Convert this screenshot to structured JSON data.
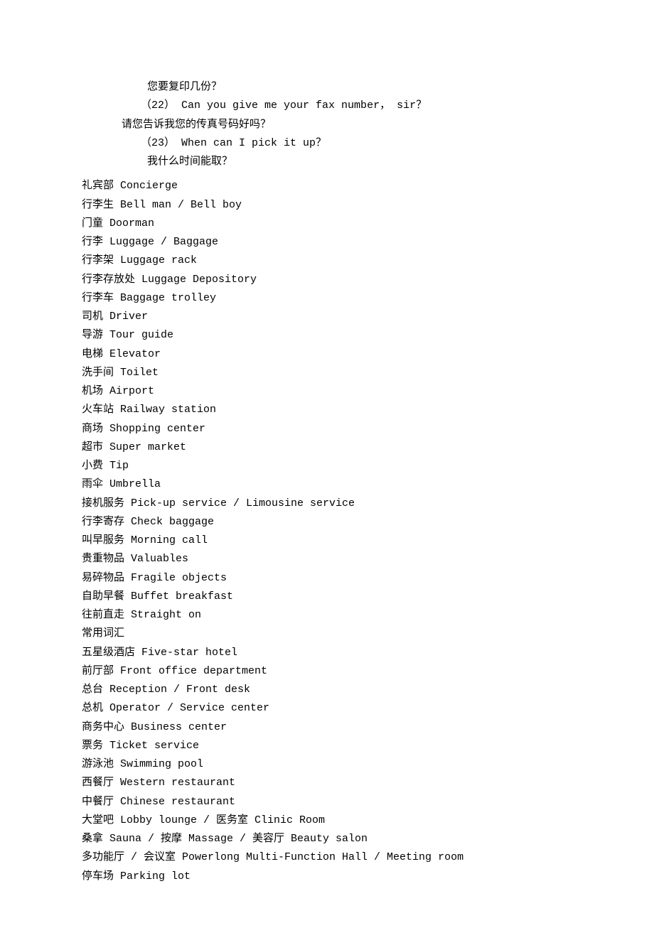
{
  "dialog": [
    "    您要复印几份？",
    "   （22） Can you give me your fax number， sir？",
    "请您告诉我您的传真号码好吗？",
    "   （23） When can I pick it up？",
    "    我什么时间能取？"
  ],
  "vocab": [
    "礼宾部 Concierge",
    "行李生 Bell man / Bell boy",
    "门童 Doorman",
    "行李 Luggage / Baggage",
    "行李架 Luggage rack",
    "行李存放处 Luggage Depository",
    "行李车 Baggage trolley",
    "司机 Driver",
    "导游 Tour guide",
    "电梯 Elevator",
    "洗手间 Toilet",
    "机场 Airport",
    "火车站 Railway station",
    "商场 Shopping center",
    "超市 Super market",
    "小费 Tip",
    "雨伞 Umbrella",
    "接机服务 Pick-up service / Limousine service",
    "行李寄存 Check baggage",
    "叫早服务 Morning call",
    "贵重物品 Valuables",
    "易碎物品 Fragile objects",
    "自助早餐 Buffet breakfast",
    "往前直走 Straight on",
    "常用词汇",
    "五星级酒店 Five-star hotel",
    "前厅部 Front office department",
    "总台 Reception / Front desk",
    "总机 Operator / Service center",
    "商务中心 Business center",
    "票务 Ticket service",
    "游泳池 Swimming pool",
    "西餐厅 Western restaurant",
    "中餐厅 Chinese restaurant",
    "大堂吧 Lobby lounge / 医务室 Clinic Room",
    "桑拿 Sauna / 按摩 Massage / 美容厅 Beauty salon",
    "多功能厅 / 会议室 Powerlong Multi-Function Hall / Meeting room",
    "停车场 Parking lot"
  ]
}
